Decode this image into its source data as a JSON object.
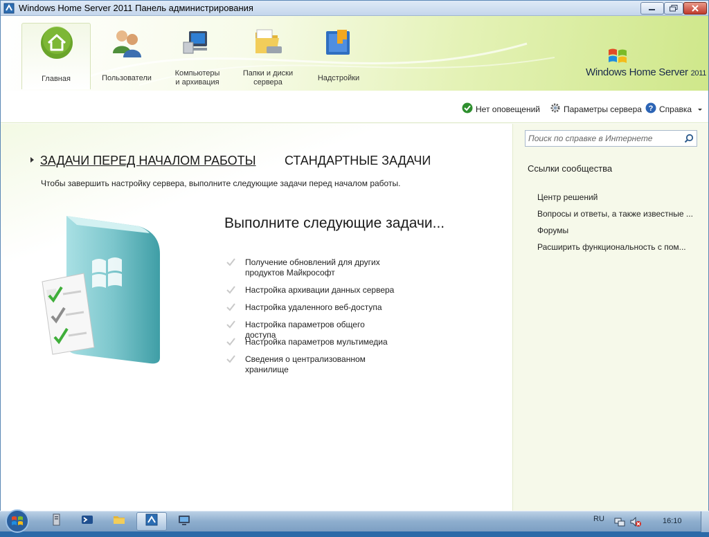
{
  "window": {
    "title": "Windows Home Server 2011 Панель администрирования"
  },
  "nav": {
    "items": [
      {
        "label": "Главная",
        "icon": "home-icon",
        "active": true
      },
      {
        "label": "Пользователи",
        "icon": "users-icon"
      },
      {
        "label": "Компьютеры\nи архивация",
        "icon": "computer-icon"
      },
      {
        "label": "Папки и диски\nсервера",
        "icon": "folder-icon"
      },
      {
        "label": "Надстройки",
        "icon": "addins-icon"
      }
    ]
  },
  "logo": {
    "text": "Windows Home Server",
    "year": "2011"
  },
  "toolbar": {
    "alerts": "Нет оповещений",
    "settings": "Параметры сервера",
    "help": "Справка"
  },
  "main": {
    "tab_getting_started": "ЗАДАЧИ ПЕРЕД НАЧАЛОМ РАБОТЫ",
    "tab_common": "СТАНДАРТНЫЕ ЗАДАЧИ",
    "subtitle": "Чтобы завершить настройку сервера, выполните следующие задачи перед началом работы.",
    "tasks_title": "Выполните следующие задачи...",
    "tasks": [
      "Получение обновлений для других продуктов Майкрософт",
      "Настройка архивации данных сервера",
      "Настройка удаленного веб-доступа",
      "Настройка параметров общего доступа",
      "Настройка параметров мультимедиа",
      "Сведения о централизованном хранилище"
    ]
  },
  "side": {
    "search_placeholder": "Поиск по справке в Интернете",
    "heading": "Ссылки сообщества",
    "links": [
      "Центр решений",
      "Вопросы и ответы, а также известные ...",
      "Форумы",
      "Расширить функциональность с пом..."
    ]
  },
  "taskbar": {
    "lang": "RU",
    "clock": "16:10"
  },
  "colors": {
    "accent_green": "#7fb526",
    "header_green": "#cfe78a",
    "taskbar_blue": "#8eaece"
  }
}
